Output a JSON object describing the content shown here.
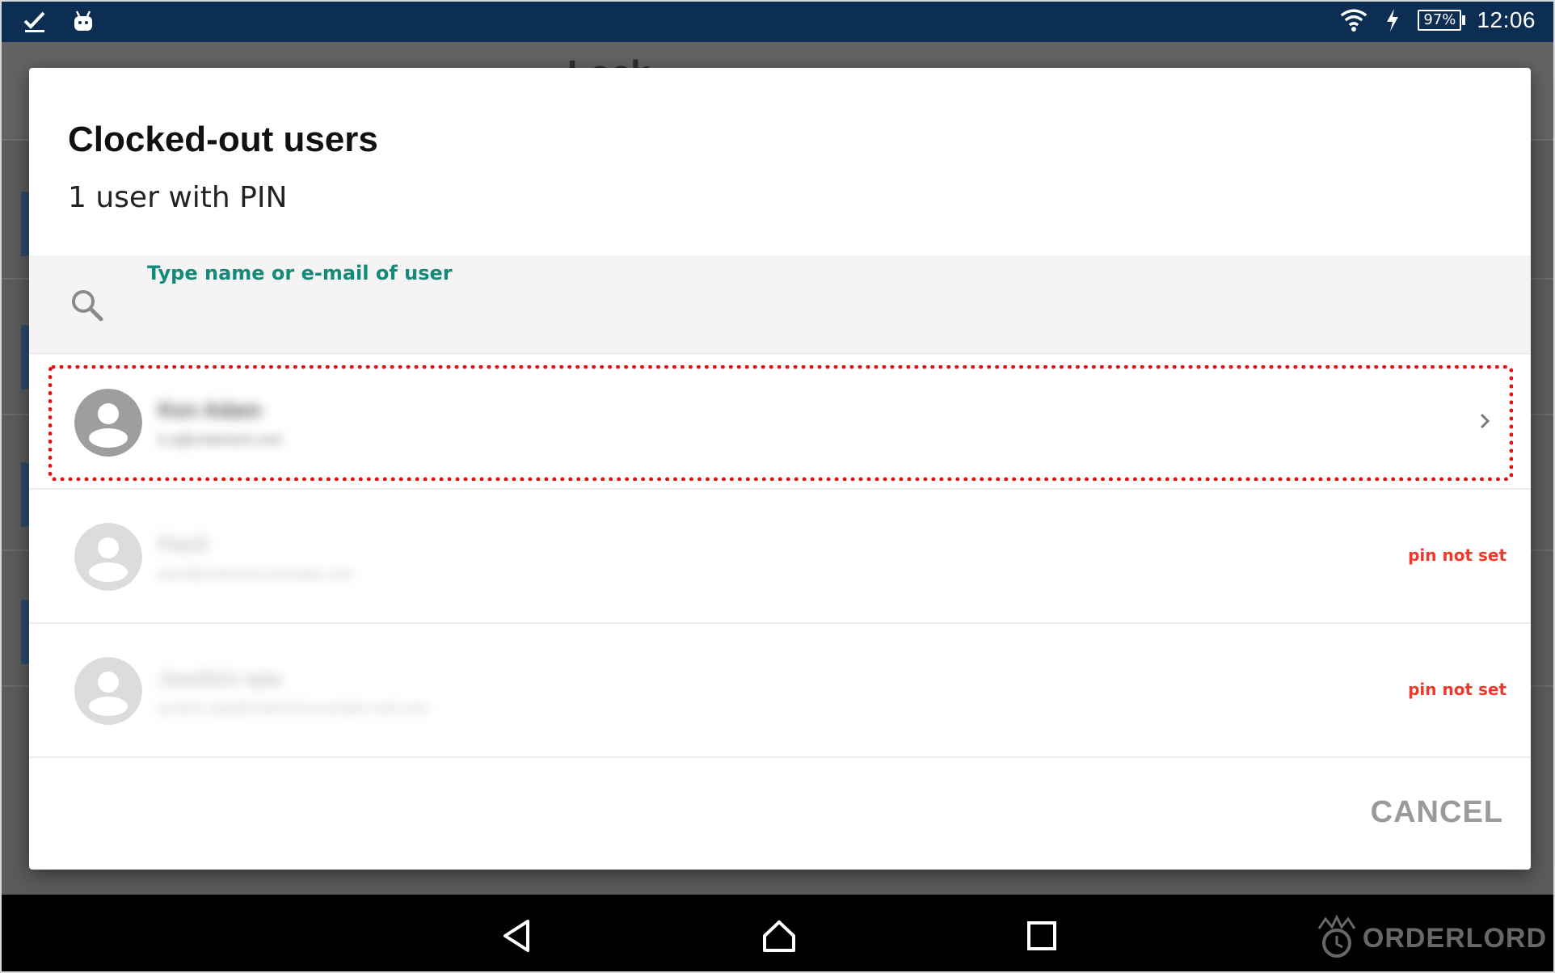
{
  "status_bar": {
    "battery_level": "97%",
    "time": "12:06",
    "icons": [
      "task-check-icon",
      "android-icon",
      "wifi-icon",
      "charging-bolt-icon",
      "battery-icon"
    ]
  },
  "dialog": {
    "title": "Clocked-out users",
    "subtitle": "1 user with PIN",
    "search": {
      "label": "Type name or e-mail of user",
      "value": ""
    },
    "users": [
      {
        "name": "Ken Adam",
        "email": "k.a@orderlord.com",
        "pin_status": ""
      },
      {
        "name": "Pauli",
        "email": "pauli@orderlord-example.com",
        "pin_status": "pin not set"
      },
      {
        "name": "Juodzio opa",
        "email": "juodzio.opa@orderlord-example-mail.com",
        "pin_status": "pin not set"
      }
    ],
    "cancel_label": "CANCEL"
  },
  "background_app": {
    "title": "Lock"
  },
  "watermark": {
    "text": "ORDERLORD"
  },
  "colors": {
    "status_bar": "#0c2e52",
    "accent_teal": "#138a7a",
    "pin_warning": "#ef3a2a",
    "highlight": "#e21313"
  }
}
